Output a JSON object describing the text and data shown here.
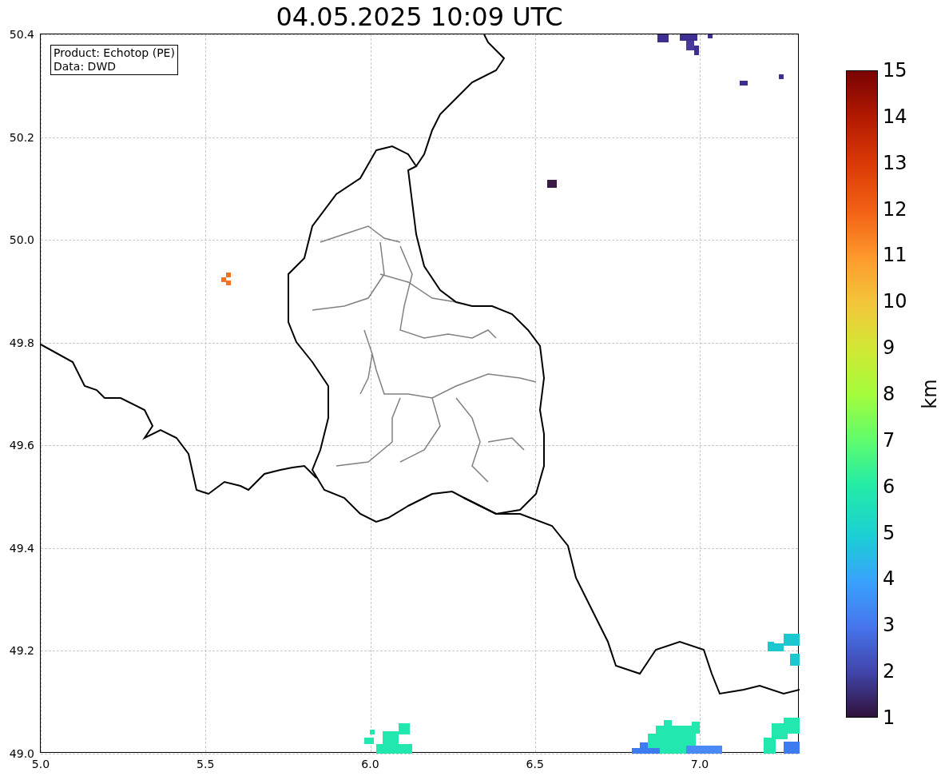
{
  "title": "04.05.2025 10:09 UTC",
  "info_box": [
    "Product: Echotop (PE)",
    "Data: DWD"
  ],
  "y_ticks": [
    "50.4",
    "50.2",
    "50.0",
    "49.8",
    "49.6",
    "49.4",
    "49.2",
    "49.0"
  ],
  "x_ticks": [
    "5.0",
    "5.5",
    "6.0",
    "6.5",
    "7.0"
  ],
  "colorbar": {
    "label": "km",
    "ticks": [
      "15",
      "14",
      "13",
      "12",
      "11",
      "10",
      "9",
      "8",
      "7",
      "6",
      "5",
      "4",
      "3",
      "2",
      "1"
    ]
  }
}
